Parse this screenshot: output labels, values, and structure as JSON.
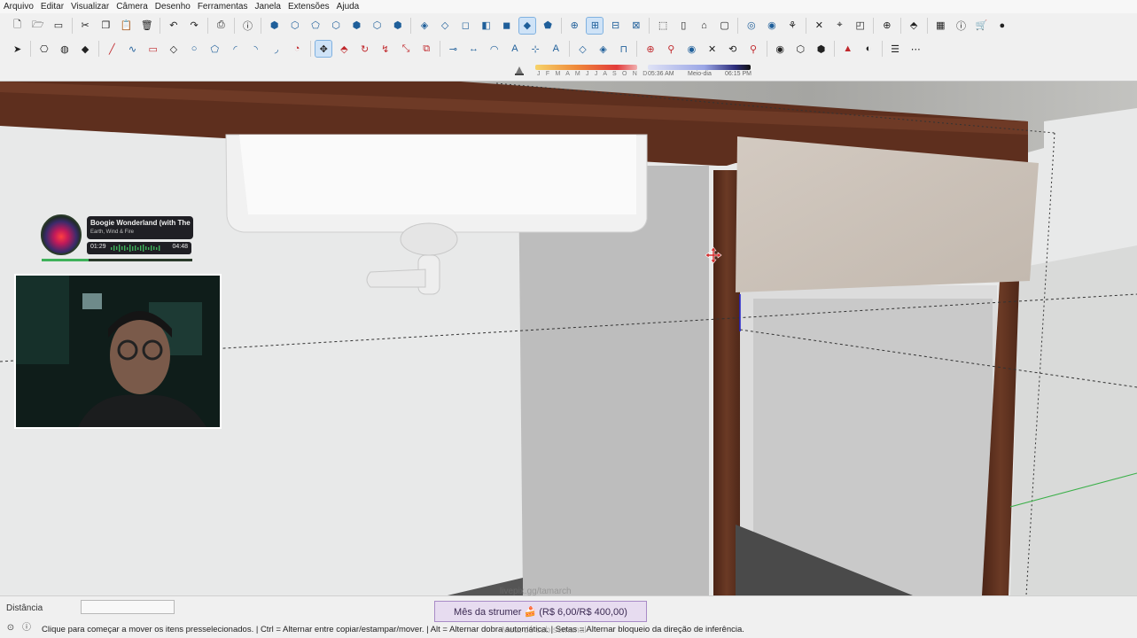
{
  "menu": [
    "Arquivo",
    "Editar",
    "Visualizar",
    "Câmera",
    "Desenho",
    "Ferramentas",
    "Janela",
    "Extensões",
    "Ajuda"
  ],
  "toolbar1_icons": [
    "new-file-icon",
    "open-file-icon",
    "save-icon",
    "sep",
    "cut-icon",
    "copy-icon",
    "paste-icon",
    "delete-icon",
    "sep",
    "undo-icon",
    "redo-icon",
    "sep",
    "print-icon",
    "sep",
    "model-info-icon",
    "sep",
    "iso-view-icon",
    "top-view-icon",
    "front-view-icon",
    "right-view-icon",
    "back-view-icon",
    "left-view-icon",
    "bottom-view-icon",
    "sep",
    "xray-icon",
    "back-edges-icon",
    "wireframe-icon",
    "hidden-line-icon",
    "shaded-icon",
    "shaded-textures-icon",
    "monochrome-icon",
    "sep",
    "section-plane-icon",
    "section-display-icon",
    "section-cuts-icon",
    "section-fill-icon",
    "sep",
    "orbit-icon",
    "pan-icon",
    "zoom-icon",
    "zoom-window-icon",
    "sep",
    "warehouse-icon",
    "extension-warehouse-icon",
    "components-icon",
    "sep",
    "add-location-icon",
    "terrain-icon",
    "photo-texture-icon",
    "sep",
    "extension-manager-icon",
    "sep",
    "add-location2-icon",
    "sep",
    "layout-icon",
    "info-icon",
    "cart-icon",
    "account-icon"
  ],
  "toolbar2_icons": [
    "select-icon",
    "sep",
    "component-icon",
    "paint-bucket-icon",
    "eraser-icon",
    "sep",
    "line-icon",
    "freehand-icon",
    "rectangle-icon",
    "rotated-rect-icon",
    "circle-icon",
    "polygon-icon",
    "arc-icon",
    "2pt-arc-icon",
    "3pt-arc-icon",
    "pie-icon",
    "sep",
    "move-icon",
    "push-pull-icon",
    "rotate-icon",
    "follow-me-icon",
    "scale-icon",
    "offset-icon",
    "sep",
    "tape-measure-icon",
    "dimension-icon",
    "protractor-icon",
    "text-icon",
    "axes-icon",
    "3d-text-icon",
    "sep",
    "outer-shell-icon",
    "intersect-icon",
    "union-icon",
    "sep",
    "position-camera-icon",
    "walk-icon",
    "look-around-icon",
    "zoom-extents-icon",
    "previous-view-icon",
    "sandbox-icon",
    "sep",
    "section-icon",
    "box-icon",
    "component-box-icon",
    "sep",
    "match-photo-icon",
    "style-icon",
    "sep",
    "outliner-icon",
    "scenes-icon"
  ],
  "toolbar1_active": [
    "shaded-textures-icon",
    "section-display-icon"
  ],
  "toolbar2_active": [
    "move-icon"
  ],
  "shadow": {
    "months": "J F M A M J J A S O N D",
    "time_start": "05:36 AM",
    "time_mid": "Meio-dia",
    "time_end": "06:15 PM"
  },
  "music": {
    "title": "Boogie Wonderland (with The",
    "artist": "Earth, Wind & Fire",
    "elapsed": "01:29",
    "total": "04:48",
    "progress": 0.31
  },
  "status": {
    "measure_label": "Distância",
    "measure_value": "",
    "hint": "Clique para começar a mover os itens presselecionados. | Ctrl = Alternar entre copiar/estampar/mover. | Alt = Alternar dobra automática. | Setas = Alternar bloqueio da direção de inferência."
  },
  "overlays": {
    "pix_text": "livepix.gg/tamarch",
    "sub_banner": "Mês da strumer 🍰 (R$ 6,00/R$ 400,00)",
    "sub_goal_faint": "Meta de sub semanal"
  },
  "colors": {
    "wood": "#5a2e1d",
    "countertop": "#a9a9a6",
    "door": "#cdc4bb",
    "sink": "#efefef",
    "accent_active": "#cfe3f7"
  }
}
